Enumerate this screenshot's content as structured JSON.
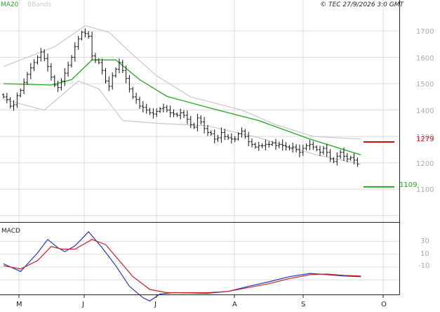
{
  "header": {
    "legend_ma20": "MA20",
    "legend_bbands": "BBands",
    "copyright": "© TEC 27/9/2026 3:0 GMT"
  },
  "colors": {
    "ma20": "#22aa22",
    "bbands": "#c8c8c8",
    "bars": "#111111",
    "resistance": "#cc1111",
    "support": "#22aa22",
    "macd": "#2233cc",
    "signal": "#cc2222",
    "grid": "#dddddd",
    "frame": "#222222",
    "axis_text": "#aaaaaa"
  },
  "chart_data": [
    {
      "type": "ohlc",
      "panel": "price",
      "title": "",
      "grid": true,
      "y_ticks": [
        "1700",
        "1600",
        "1500",
        "1400",
        "1300",
        "1200",
        "1100"
      ],
      "ylim": [
        1000,
        1740
      ],
      "x_month_labels": [
        "M",
        "J",
        "J",
        "A",
        "S",
        "O"
      ],
      "resistance": {
        "value": 1279,
        "label": "1279"
      },
      "support": {
        "value": 1109,
        "label": "1109"
      },
      "close_series": [
        1450,
        1440,
        1415,
        1420,
        1455,
        1475,
        1505,
        1535,
        1560,
        1580,
        1600,
        1620,
        1595,
        1565,
        1525,
        1495,
        1485,
        1510,
        1540,
        1570,
        1600,
        1640,
        1670,
        1695,
        1690,
        1680,
        1605,
        1590,
        1580,
        1550,
        1510,
        1490,
        1530,
        1555,
        1580,
        1550,
        1520,
        1480,
        1450,
        1440,
        1415,
        1410,
        1400,
        1390,
        1385,
        1395,
        1405,
        1410,
        1400,
        1390,
        1385,
        1380,
        1390,
        1380,
        1365,
        1345,
        1335,
        1370,
        1355,
        1330,
        1315,
        1310,
        1290,
        1295,
        1315,
        1300,
        1295,
        1290,
        1290,
        1310,
        1320,
        1300,
        1280,
        1270,
        1260,
        1265,
        1265,
        1270,
        1270,
        1275,
        1265,
        1270,
        1265,
        1260,
        1255,
        1260,
        1250,
        1240,
        1255,
        1265,
        1270,
        1260,
        1250,
        1240,
        1255,
        1240,
        1215,
        1205,
        1225,
        1240,
        1225,
        1215,
        1220,
        1210,
        1195
      ],
      "ma20": [
        {
          "x": 0,
          "y": 1500
        },
        {
          "x": 14,
          "y": 1495
        },
        {
          "x": 20,
          "y": 1515
        },
        {
          "x": 26,
          "y": 1590
        },
        {
          "x": 33,
          "y": 1590
        },
        {
          "x": 40,
          "y": 1515
        },
        {
          "x": 48,
          "y": 1452
        },
        {
          "x": 60,
          "y": 1410
        },
        {
          "x": 75,
          "y": 1360
        },
        {
          "x": 90,
          "y": 1290
        },
        {
          "x": 105,
          "y": 1230
        }
      ],
      "bband_upper": [
        {
          "x": 0,
          "y": 1565
        },
        {
          "x": 15,
          "y": 1640
        },
        {
          "x": 24,
          "y": 1720
        },
        {
          "x": 31,
          "y": 1695
        },
        {
          "x": 38,
          "y": 1610
        },
        {
          "x": 45,
          "y": 1530
        },
        {
          "x": 55,
          "y": 1450
        },
        {
          "x": 70,
          "y": 1400
        },
        {
          "x": 80,
          "y": 1345
        },
        {
          "x": 91,
          "y": 1300
        },
        {
          "x": 105,
          "y": 1290
        }
      ],
      "bband_lower": [
        {
          "x": 0,
          "y": 1440
        },
        {
          "x": 12,
          "y": 1400
        },
        {
          "x": 22,
          "y": 1510
        },
        {
          "x": 28,
          "y": 1480
        },
        {
          "x": 35,
          "y": 1360
        },
        {
          "x": 45,
          "y": 1350
        },
        {
          "x": 60,
          "y": 1340
        },
        {
          "x": 75,
          "y": 1295
        },
        {
          "x": 92,
          "y": 1230
        },
        {
          "x": 105,
          "y": 1195
        }
      ]
    },
    {
      "type": "line",
      "panel": "macd",
      "title": "MACD",
      "grid": true,
      "y_ticks": [
        "30",
        "10",
        "-10"
      ],
      "ylim": [
        -80,
        50
      ],
      "series": [
        {
          "points": [
            {
              "x": 0,
              "y": -5
            },
            {
              "x": 5,
              "y": -17
            },
            {
              "x": 10,
              "y": 12
            },
            {
              "x": 13,
              "y": 33
            },
            {
              "x": 16,
              "y": 20
            },
            {
              "x": 18,
              "y": 14
            },
            {
              "x": 21,
              "y": 23
            },
            {
              "x": 25,
              "y": 45
            },
            {
              "x": 29,
              "y": 20
            },
            {
              "x": 33,
              "y": -8
            },
            {
              "x": 37,
              "y": -40
            },
            {
              "x": 41,
              "y": -58
            },
            {
              "x": 43,
              "y": -63
            },
            {
              "x": 46,
              "y": -52
            },
            {
              "x": 50,
              "y": -50
            },
            {
              "x": 60,
              "y": -51
            },
            {
              "x": 66,
              "y": -48
            },
            {
              "x": 72,
              "y": -40
            },
            {
              "x": 78,
              "y": -33
            },
            {
              "x": 84,
              "y": -25
            },
            {
              "x": 90,
              "y": -20
            },
            {
              "x": 95,
              "y": -22
            },
            {
              "x": 100,
              "y": -24
            },
            {
              "x": 105,
              "y": -25
            }
          ]
        },
        {
          "points": [
            {
              "x": 0,
              "y": -8
            },
            {
              "x": 5,
              "y": -13
            },
            {
              "x": 10,
              "y": 0
            },
            {
              "x": 14,
              "y": 22
            },
            {
              "x": 17,
              "y": 18
            },
            {
              "x": 21,
              "y": 18
            },
            {
              "x": 26,
              "y": 33
            },
            {
              "x": 30,
              "y": 25
            },
            {
              "x": 34,
              "y": 0
            },
            {
              "x": 38,
              "y": -25
            },
            {
              "x": 43,
              "y": -45
            },
            {
              "x": 48,
              "y": -50
            },
            {
              "x": 60,
              "y": -50
            },
            {
              "x": 66,
              "y": -48
            },
            {
              "x": 72,
              "y": -42
            },
            {
              "x": 78,
              "y": -36
            },
            {
              "x": 84,
              "y": -28
            },
            {
              "x": 90,
              "y": -22
            },
            {
              "x": 95,
              "y": -21
            },
            {
              "x": 100,
              "y": -23
            },
            {
              "x": 105,
              "y": -24
            }
          ]
        }
      ]
    }
  ]
}
